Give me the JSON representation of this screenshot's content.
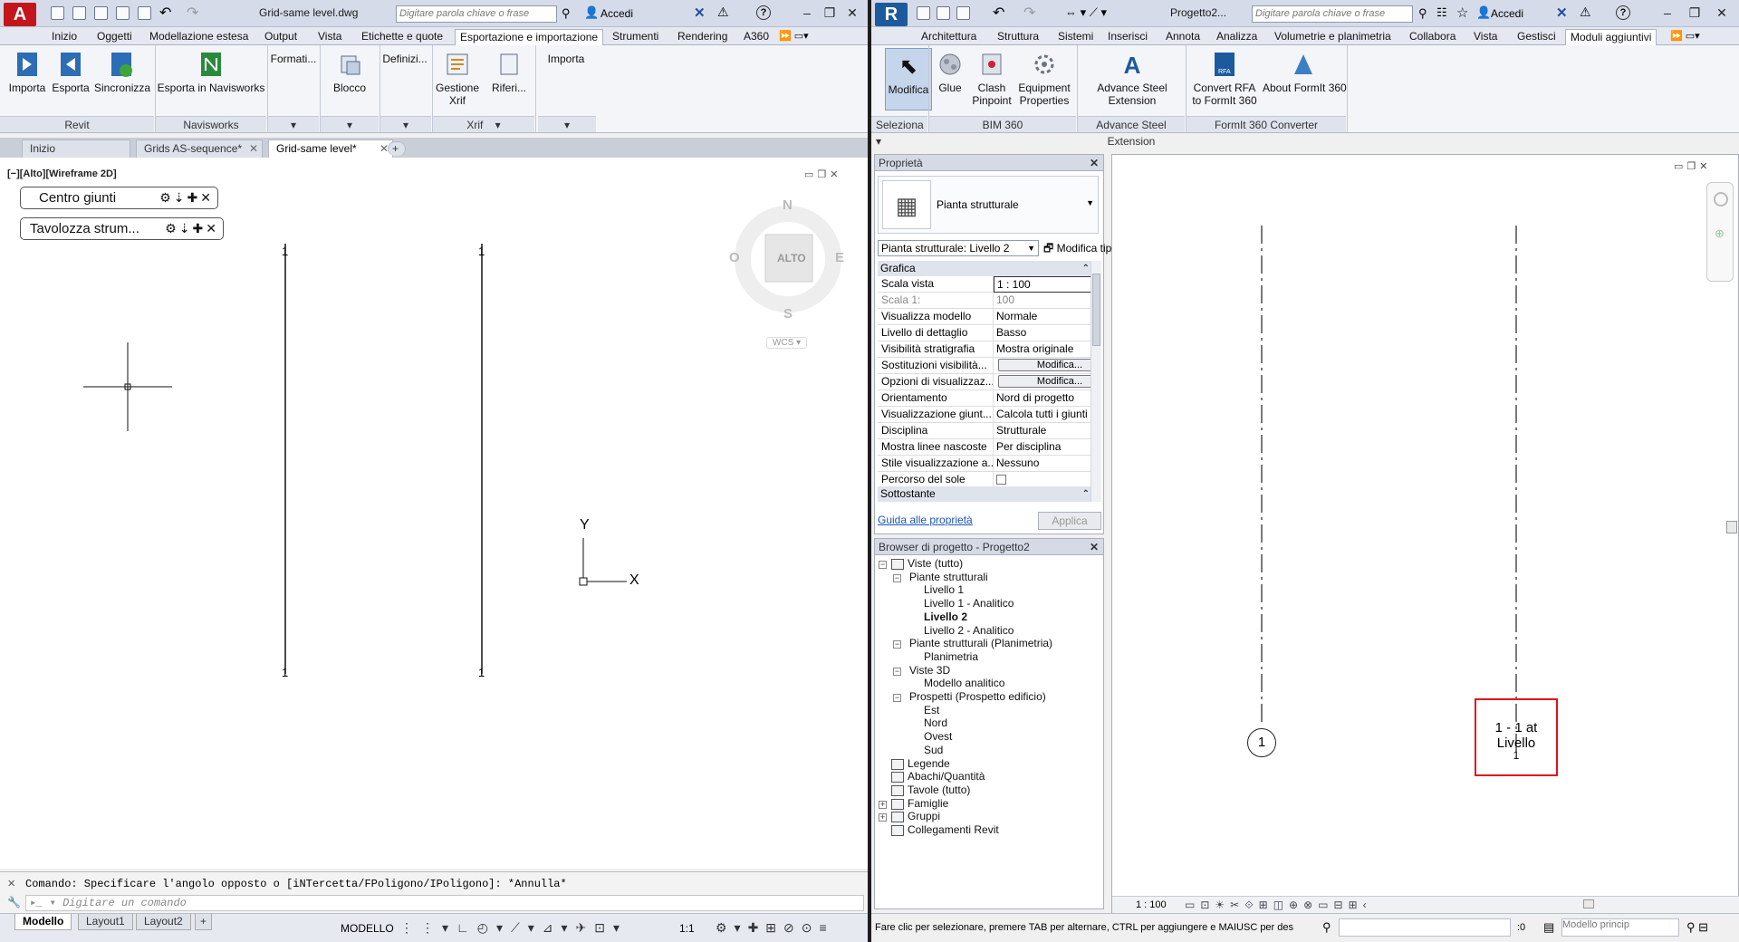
{
  "autocad": {
    "title": "Grid-same level.dwg",
    "search_placeholder": "Digitare parola chiave o frase",
    "signin": "Accedi",
    "tabs": [
      "Inizio",
      "Oggetti",
      "Modellazione estesa",
      "Output",
      "Vista",
      "Etichette e quote",
      "Esportazione e importazione",
      "Strumenti",
      "Rendering",
      "A360"
    ],
    "ribbon": {
      "revit_buttons": [
        "Importa",
        "Esporta",
        "Sincronizza"
      ],
      "revit_panel": "Revit",
      "navisworks_button": "Esporta in Navisworks",
      "navisworks_panel": "Navisworks",
      "formati": "Formati...",
      "blocco": "Blocco",
      "definizi": "Definizi...",
      "gestione_xrif": "Gestione Xrif",
      "riferi": "Riferi...",
      "xrif_panel": "Xrif",
      "importa": "Importa"
    },
    "doc_tabs": [
      "Inizio",
      "Grids AS-sequence*",
      "Grid-same level*"
    ],
    "viewport_label": "[−][Alto][Wireframe 2D]",
    "palettes": [
      "Centro giunti",
      "Tavolozza strum..."
    ],
    "viewcube": {
      "n": "N",
      "s": "S",
      "e": "E",
      "w": "O",
      "face": "ALTO",
      "wcs": "WCS"
    },
    "grid_labels": [
      "1",
      "1",
      "1",
      "1"
    ],
    "ucs": {
      "x": "X",
      "y": "Y"
    },
    "command_history": "Comando: Specificare l'angolo opposto o [iNTercetta/FPoligono/IPoligono]: *Annulla*",
    "command_placeholder": "Digitare un comando",
    "layouts": [
      "Modello",
      "Layout1",
      "Layout2"
    ],
    "status_model": "MODELLO",
    "status_scale": "1:1"
  },
  "revit": {
    "title": "Progetto2...",
    "search_placeholder": "Digitare parola chiave o frase",
    "signin": "Accedi",
    "tabs": [
      "Architettura",
      "Struttura",
      "Sistemi",
      "Inserisci",
      "Annota",
      "Analizza",
      "Volumetrie e planimetria",
      "Collabora",
      "Vista",
      "Gestisci",
      "Moduli aggiuntivi"
    ],
    "ribbon": {
      "modifica": "Modifica",
      "seleziona": "Seleziona",
      "glue": "Glue",
      "clash": "Clash Pinpoint",
      "equipment": "Equipment Properties",
      "bim360": "BIM 360",
      "advance_steel": "Advance Steel Extension",
      "advance_steel_panel": "Advance Steel Extension",
      "convert_rfa": "Convert RFA to FormIt 360",
      "about_formit": "About FormIt 360",
      "formit_panel": "FormIt 360 Converter"
    },
    "properties": {
      "title": "Proprietà",
      "type_name": "Pianta strutturale",
      "selector": "Pianta strutturale: Livello 2",
      "edit_type": "Modifica tipo",
      "group_grafica": "Grafica",
      "rows": [
        {
          "label": "Scala vista",
          "value": "1 : 100"
        },
        {
          "label": "Scala 1:",
          "value": "100"
        },
        {
          "label": "Visualizza modello",
          "value": "Normale"
        },
        {
          "label": "Livello di dettaglio",
          "value": "Basso"
        },
        {
          "label": "Visibilità stratigrafia",
          "value": "Mostra originale"
        },
        {
          "label": "Sostituzioni visibilità...",
          "value": "Modifica..."
        },
        {
          "label": "Opzioni di visualizzaz...",
          "value": "Modifica..."
        },
        {
          "label": "Orientamento",
          "value": "Nord di progetto"
        },
        {
          "label": "Visualizzazione giunt...",
          "value": "Calcola tutti i giunti d..."
        },
        {
          "label": "Disciplina",
          "value": "Strutturale"
        },
        {
          "label": "Mostra linee nascoste",
          "value": "Per disciplina"
        },
        {
          "label": "Stile visualizzazione a...",
          "value": "Nessuno"
        },
        {
          "label": "Percorso del sole",
          "value": ""
        }
      ],
      "group_sottostante": "Sottostante",
      "help_link": "Guida alle proprietà",
      "apply": "Applica"
    },
    "browser": {
      "title": "Browser di progetto - Progetto2",
      "items": [
        {
          "label": "Viste (tutto)",
          "level": 0,
          "toggle": "−",
          "icon": true
        },
        {
          "label": "Piante strutturali",
          "level": 1,
          "toggle": "−"
        },
        {
          "label": "Livello 1",
          "level": 2
        },
        {
          "label": "Livello 1 - Analitico",
          "level": 2
        },
        {
          "label": "Livello 2",
          "level": 2,
          "bold": true
        },
        {
          "label": "Livello 2 - Analitico",
          "level": 2
        },
        {
          "label": "Piante strutturali (Planimetria)",
          "level": 1,
          "toggle": "−"
        },
        {
          "label": "Planimetria",
          "level": 2
        },
        {
          "label": "Viste 3D",
          "level": 1,
          "toggle": "−"
        },
        {
          "label": "Modello analitico",
          "level": 2
        },
        {
          "label": "Prospetti (Prospetto edificio)",
          "level": 1,
          "toggle": "−"
        },
        {
          "label": "Est",
          "level": 2
        },
        {
          "label": "Nord",
          "level": 2
        },
        {
          "label": "Ovest",
          "level": 2
        },
        {
          "label": "Sud",
          "level": 2
        },
        {
          "label": "Legende",
          "level": 0,
          "icon": true
        },
        {
          "label": "Abachi/Quantità",
          "level": 0,
          "icon": true
        },
        {
          "label": "Tavole (tutto)",
          "level": 0,
          "icon": true
        },
        {
          "label": "Famiglie",
          "level": 0,
          "toggle": "+",
          "icon": true
        },
        {
          "label": "Gruppi",
          "level": 0,
          "toggle": "+",
          "icon": true
        },
        {
          "label": "Collegamenti Revit",
          "level": 0,
          "icon": true
        }
      ]
    },
    "view": {
      "grid_bubble": "1",
      "callout_line1": "1 - 1 at",
      "callout_line2": "Livello",
      "callout_line3": "1",
      "scale": "1 : 100"
    },
    "status_text": "Fare clic per selezionare, premere TAB per alternare, CTRL per aggiungere e MAIUSC per des",
    "status_zero": ":0",
    "status_model": "Modello princip"
  },
  "colors": {
    "autocad_red": "#c3161c",
    "revit_blue": "#1c5a9e",
    "highlight_red": "#e0141c"
  }
}
